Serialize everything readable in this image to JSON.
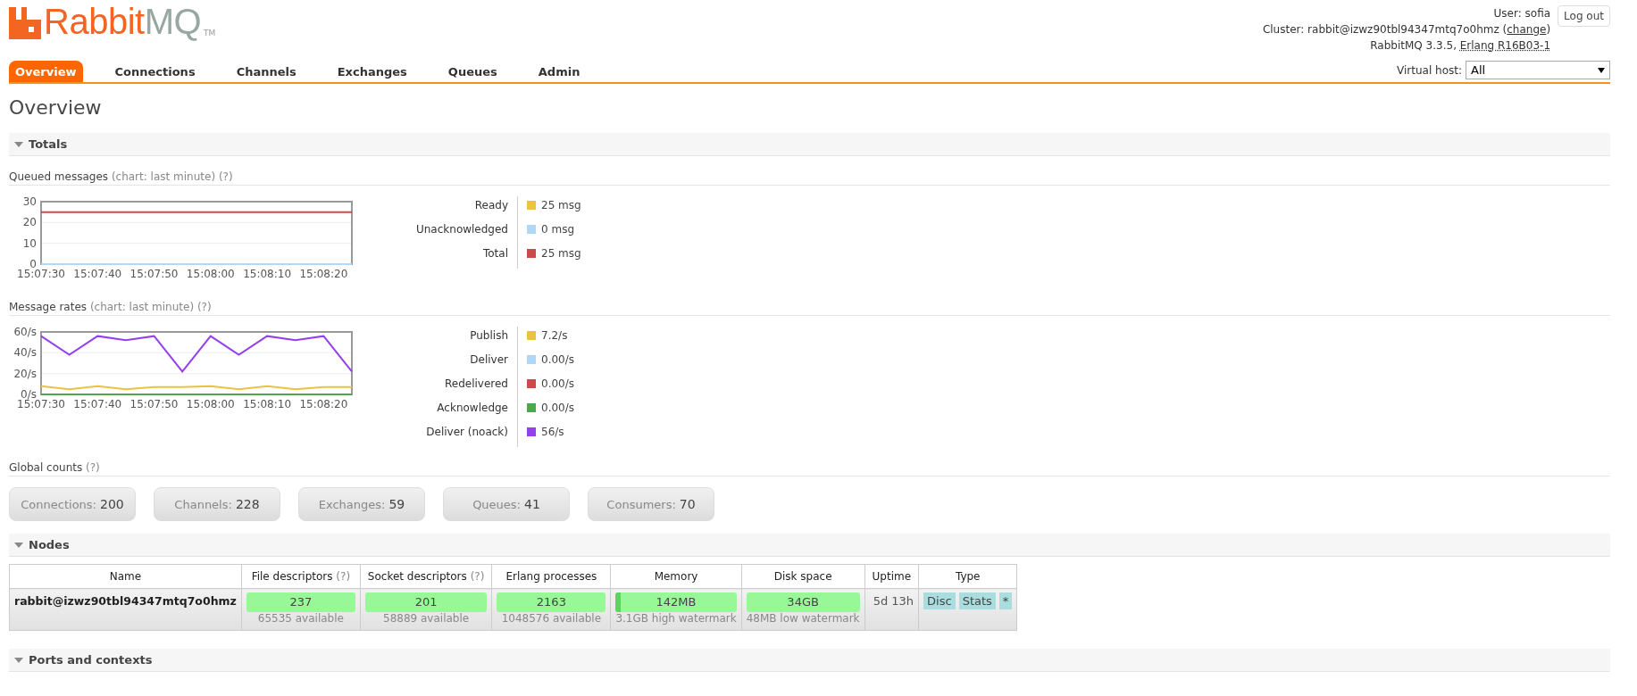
{
  "logo": {
    "brand": "Rabbit",
    "brand_suffix": "MQ",
    "trademark": "TM"
  },
  "header": {
    "user_line": "User: sofia",
    "cluster_text": "Cluster: rabbit@izwz90tbl94347mtq7o0hmz (",
    "change_link": "change",
    "cluster_suffix": ")",
    "version_text": "RabbitMQ 3.3.5, ",
    "erlang_link": "Erlang R16B03-1",
    "logout": "Log out",
    "vhost_label": "Virtual host:",
    "vhost_value": "All"
  },
  "tabs": [
    {
      "label": "Overview",
      "selected": true
    },
    {
      "label": "Connections",
      "selected": false
    },
    {
      "label": "Channels",
      "selected": false
    },
    {
      "label": "Exchanges",
      "selected": false
    },
    {
      "label": "Queues",
      "selected": false
    },
    {
      "label": "Admin",
      "selected": false
    }
  ],
  "page_title": "Overview",
  "totals": {
    "title": "Totals",
    "expanded": true,
    "charts": [
      {
        "title": "Queued messages",
        "subtitle": "(chart: last minute)",
        "help": "(?)",
        "chart_data": {
          "type": "line",
          "categories": [
            "15:07:30",
            null,
            "15:07:40",
            null,
            "15:07:50",
            null,
            "15:08:00",
            null,
            "15:08:10",
            null,
            "15:08:20",
            null
          ],
          "ylim": [
            0,
            30
          ],
          "yticks": [
            0,
            10,
            20,
            30
          ],
          "series": [
            {
              "name": "Ready",
              "color": "#edc240",
              "values": [
                null,
                null,
                null,
                null,
                null,
                null,
                null,
                null,
                null,
                null,
                null,
                null
              ]
            },
            {
              "name": "Unacknowledged",
              "color": "#afd8f8",
              "values": [
                0,
                0,
                0,
                0,
                0,
                0,
                0,
                0,
                0,
                0,
                0,
                0
              ]
            },
            {
              "name": "Total",
              "color": "#cb4b4b",
              "values": [
                25,
                25,
                25,
                25,
                25,
                25,
                25,
                25,
                25,
                25,
                25,
                25
              ]
            }
          ]
        },
        "readings": [
          "25 msg",
          "0 msg",
          "25 msg"
        ]
      },
      {
        "title": "Message rates",
        "subtitle": "(chart: last minute)",
        "help": "(?)",
        "chart_data": {
          "type": "line",
          "categories": [
            "15:07:30",
            null,
            "15:07:40",
            null,
            "15:07:50",
            null,
            "15:08:00",
            null,
            "15:08:10",
            null,
            "15:08:20",
            null
          ],
          "ylim": [
            0,
            60
          ],
          "yticks": [
            {
              "value": 0,
              "label": "0/s"
            },
            {
              "value": 20,
              "label": "20/s"
            },
            {
              "value": 40,
              "label": "40/s"
            },
            {
              "value": 60,
              "label": "60/s"
            }
          ],
          "series": [
            {
              "name": "Publish",
              "color": "#edc240",
              "values": [
                8,
                5,
                8,
                5,
                7,
                7,
                8,
                5,
                8,
                5,
                7,
                7
              ]
            },
            {
              "name": "Deliver",
              "color": "#afd8f8",
              "values": [
                null,
                null,
                null,
                null,
                null,
                null,
                null,
                null,
                null,
                null,
                null,
                null
              ]
            },
            {
              "name": "Redelivered",
              "color": "#cb4b4b",
              "values": [
                null,
                null,
                null,
                null,
                null,
                null,
                null,
                null,
                null,
                null,
                null,
                null
              ]
            },
            {
              "name": "Acknowledge",
              "color": "#4da74d",
              "values": [
                0,
                0,
                0,
                0,
                0,
                0,
                0,
                0,
                0,
                0,
                0,
                0
              ]
            },
            {
              "name": "Deliver (noack)",
              "color": "#9440ed",
              "values": [
                56,
                38,
                56,
                52,
                56,
                22,
                56,
                38,
                56,
                52,
                56,
                22
              ]
            }
          ]
        },
        "readings": [
          "7.2/s",
          "0.00/s",
          "0.00/s",
          "0.00/s",
          "56/s"
        ]
      }
    ],
    "global_counts": {
      "title": "Global counts",
      "help": "(?)",
      "counts": [
        {
          "label": "Connections:",
          "value": "200"
        },
        {
          "label": "Channels:",
          "value": "228"
        },
        {
          "label": "Exchanges:",
          "value": "59"
        },
        {
          "label": "Queues:",
          "value": "41"
        },
        {
          "label": "Consumers:",
          "value": "70"
        }
      ]
    }
  },
  "nodes": {
    "title": "Nodes",
    "expanded": true,
    "columns": [
      {
        "label": "Name"
      },
      {
        "label": "File descriptors",
        "help": "(?)"
      },
      {
        "label": "Socket descriptors",
        "help": "(?)"
      },
      {
        "label": "Erlang processes"
      },
      {
        "label": "Memory"
      },
      {
        "label": "Disk space"
      },
      {
        "label": "Uptime"
      },
      {
        "label": "Type"
      }
    ],
    "rows": [
      {
        "name": "rabbit@izwz90tbl94347mtq7o0hmz",
        "bars": [
          {
            "value": "237",
            "sub": "65535 available"
          },
          {
            "value": "201",
            "sub": "58889 available"
          },
          {
            "value": "2163",
            "sub": "1048576 available"
          },
          {
            "value": "142MB",
            "sub": "3.1GB high watermark",
            "level": 0.04
          },
          {
            "value": "34GB",
            "sub": "48MB low watermark"
          }
        ],
        "uptime": "5d 13h",
        "types": [
          "Disc",
          "Stats",
          "*"
        ]
      }
    ]
  },
  "ports": {
    "title": "Ports and contexts",
    "expanded": true
  }
}
